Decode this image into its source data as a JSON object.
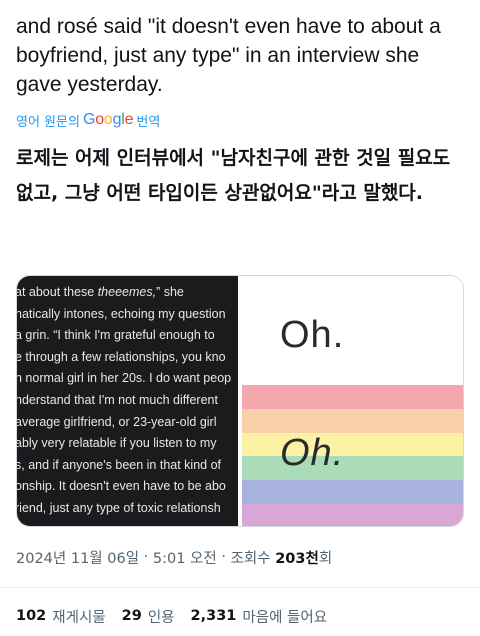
{
  "post": {
    "text": "and rosé said \"it doesn't even have to about a boyfriend, just any type\" in an interview she gave yesterday."
  },
  "translation": {
    "prefix": "영어 원문의",
    "provider": "Google",
    "suffix": "번역",
    "text": "로제는 어제 인터뷰에서 \"남자친구에 관한 것일 필요도 없고, 그냥 어떤 타입이든 상관없어요\"라고 말했다."
  },
  "media": {
    "article_lines": [
      "at about these ",
      "natically intones, echoing my question",
      "a grin. “I think I'm grateful enough to",
      "e through a few relationships, you kno",
      "n normal girl in her 20s. I do want peop",
      "nderstand that I'm not much different",
      " average girlfriend, or 23-year-old girl",
      "ably very relatable if you listen to my",
      "s, and if anyone's been in that kind of",
      "onship. It doesn't even have to be abo",
      "riend, just any type of toxic relationsh"
    ],
    "article_emphasis": "theeemes,",
    "article_line1_tail": "” she",
    "oh_top": "Oh.",
    "oh_bottom": "Oh.",
    "rainbow_colors": [
      "#f4a7ad",
      "#f9d0a8",
      "#fbf2a6",
      "#a9dcb7",
      "#a7b3de",
      "#d9a7d6"
    ]
  },
  "meta": {
    "date": "2024년 11월 06일",
    "time": "5:01 오전",
    "views_label": "조회수",
    "views_num": "203천",
    "views_suffix": "회"
  },
  "stats": {
    "retweets_num": "102",
    "retweets_label": "재게시물",
    "quotes_num": "29",
    "quotes_label": "인용",
    "likes_num": "2,331",
    "likes_label": "마음에 들어요"
  }
}
